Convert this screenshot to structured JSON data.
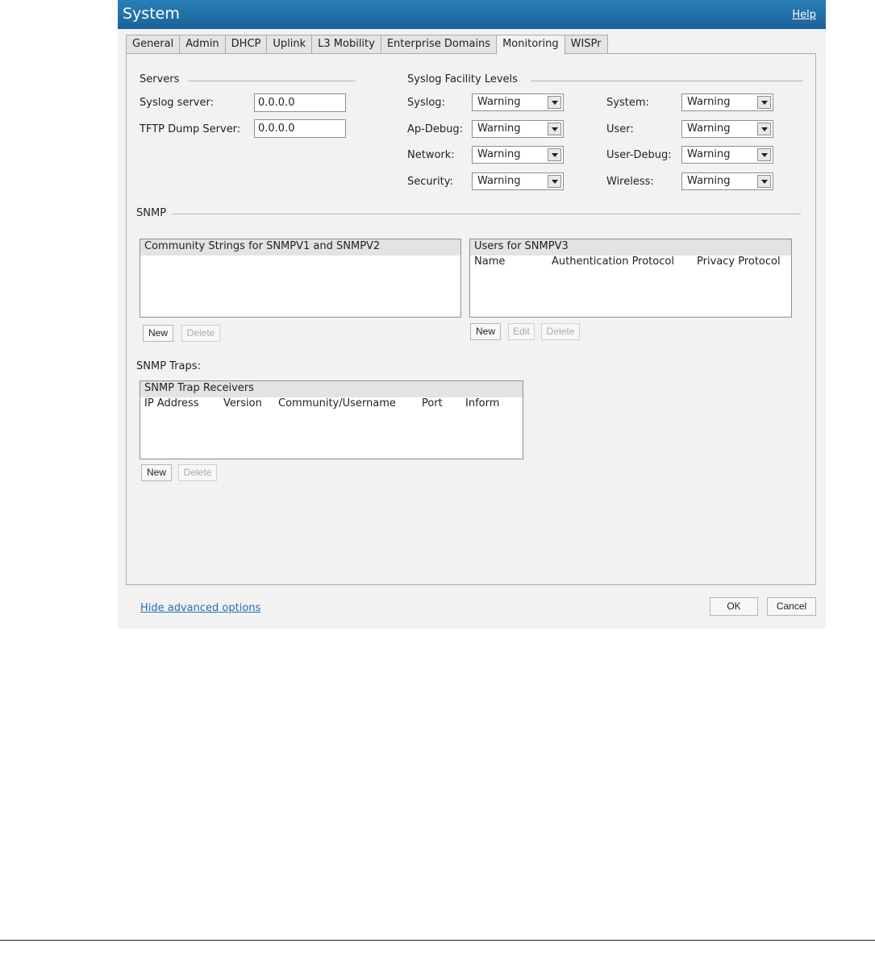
{
  "window": {
    "title": "System",
    "help": "Help"
  },
  "tabs": [
    {
      "label": "General"
    },
    {
      "label": "Admin"
    },
    {
      "label": "DHCP"
    },
    {
      "label": "Uplink"
    },
    {
      "label": "L3 Mobility"
    },
    {
      "label": "Enterprise Domains"
    },
    {
      "label": "Monitoring",
      "active": true
    },
    {
      "label": "WISPr"
    }
  ],
  "servers": {
    "section": "Servers",
    "syslog_label": "Syslog server:",
    "syslog_value": "0.0.0.0",
    "tftp_label": "TFTP Dump Server:",
    "tftp_value": "0.0.0.0"
  },
  "syslog_levels": {
    "section": "Syslog Facility Levels",
    "items": [
      {
        "label": "Syslog:",
        "value": "Warning"
      },
      {
        "label": "Ap-Debug:",
        "value": "Warning"
      },
      {
        "label": "Network:",
        "value": "Warning"
      },
      {
        "label": "Security:",
        "value": "Warning"
      },
      {
        "label": "System:",
        "value": "Warning"
      },
      {
        "label": "User:",
        "value": "Warning"
      },
      {
        "label": "User-Debug:",
        "value": "Warning"
      },
      {
        "label": "Wireless:",
        "value": "Warning"
      }
    ]
  },
  "snmp": {
    "section": "SNMP",
    "community_header": "Community Strings for SNMPV1 and SNMPV2",
    "v3_header": "Users for SNMPV3",
    "v3_columns": [
      "Name",
      "Authentication Protocol",
      "Privacy Protocol"
    ],
    "btn_new": "New",
    "btn_edit": "Edit",
    "btn_delete": "Delete"
  },
  "traps": {
    "section": "SNMP Traps:",
    "header": "SNMP Trap Receivers",
    "columns": [
      "IP Address",
      "Version",
      "Community/Username",
      "Port",
      "Inform"
    ]
  },
  "footer": {
    "link": "Hide advanced options",
    "ok": "OK",
    "cancel": "Cancel"
  },
  "colors": {
    "titlebar": "#1f6fa8",
    "link": "#2a6db0",
    "panel_bg": "#f2f2f2"
  }
}
